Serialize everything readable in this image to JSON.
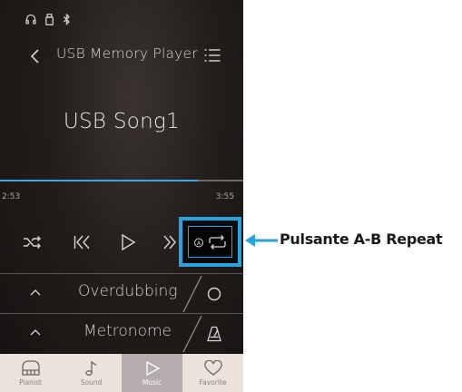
{
  "status_bar": {
    "icons": [
      "headphones-icon",
      "usb-drive-icon",
      "bluetooth-icon"
    ]
  },
  "header": {
    "back_icon": "chevron-left-icon",
    "title": "USB Memory Player",
    "menu_icon": "list-icon"
  },
  "player": {
    "song_title": "USB Song1",
    "time_elapsed": "2:53",
    "time_total": "3:55",
    "progress": 0.815
  },
  "controls": {
    "items": [
      "shuffle-icon",
      "skip-back-icon",
      "play-icon",
      "fast-forward-icon",
      "ab-repeat-icon"
    ]
  },
  "rows": [
    {
      "label": "Overdubbing",
      "icon": "record-circle-icon"
    },
    {
      "label": "Metronome",
      "icon": "metronome-icon"
    }
  ],
  "tabs": [
    {
      "label": "Pianist",
      "icon": "piano-icon",
      "active": false
    },
    {
      "label": "Sound",
      "icon": "music-note-icon",
      "active": false
    },
    {
      "label": "Music",
      "icon": "play-icon",
      "active": true
    },
    {
      "label": "Favorite",
      "icon": "heart-icon",
      "active": false
    }
  ],
  "annotation": {
    "label": "Pulsante A-B Repeat"
  },
  "colors": {
    "accent": "#27a3df",
    "progress": "#3aa9e4",
    "tab_bg": "#ece2dc",
    "tab_active_bg": "#b5acae"
  }
}
